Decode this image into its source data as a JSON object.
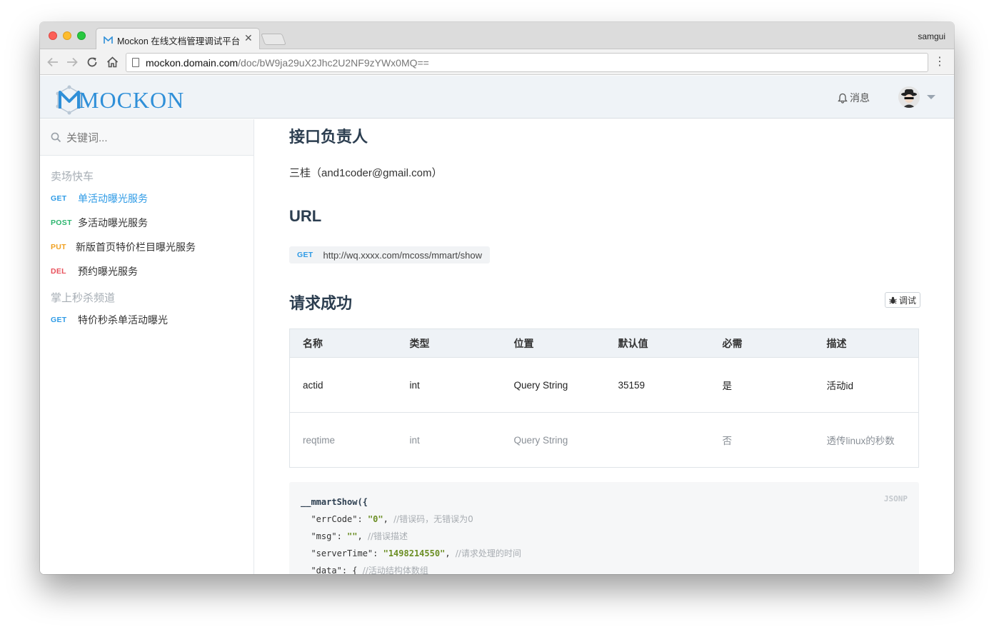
{
  "browser": {
    "tab_title": "Mockon 在线文档管理调试平台",
    "tab_close": "✕",
    "profile_name": "samgui",
    "url_host": "mockon.domain.com",
    "url_path": "/doc/bW9ja29uX2Jhc2U2NF9zYWx0MQ=="
  },
  "header": {
    "logo_text": "MOCKON",
    "notify_label": "消息"
  },
  "sidebar": {
    "search_placeholder": "关键词...",
    "groups": [
      {
        "title": "卖场快车",
        "items": [
          {
            "method": "GET",
            "label": "单活动曝光服务",
            "active": true
          },
          {
            "method": "POST",
            "label": "多活动曝光服务",
            "active": false
          },
          {
            "method": "PUT",
            "label": "新版首页特价栏目曝光服务",
            "active": false
          },
          {
            "method": "DEL",
            "label": "预约曝光服务",
            "active": false
          }
        ]
      },
      {
        "title": "掌上秒杀频道",
        "items": [
          {
            "method": "GET",
            "label": "特价秒杀单活动曝光",
            "active": false
          }
        ]
      }
    ]
  },
  "main": {
    "owner_heading": "接口负责人",
    "owner_text": "三桂（and1coder@gmail.com）",
    "url_heading": "URL",
    "url_method": "GET",
    "url_value": "http://wq.xxxx.com/mcoss/mmart/show",
    "success_heading": "请求成功",
    "debug_label": "调试",
    "table": {
      "headers": [
        "名称",
        "类型",
        "位置",
        "默认值",
        "必需",
        "描述"
      ],
      "rows": [
        [
          "actid",
          "int",
          "Query String",
          "35159",
          "是",
          "活动id"
        ],
        [
          "reqtime",
          "int",
          "Query String",
          "",
          "否",
          "透传linux的秒数"
        ]
      ]
    },
    "code": {
      "lang": "JSONP",
      "fn": "__mmartShow",
      "open": "({",
      "lines": [
        {
          "key": "\"errCode\"",
          "value": "\"0\"",
          "comment": "//错误码，无错误为0"
        },
        {
          "key": "\"msg\"",
          "value": "\"\"",
          "comment": "//错误描述"
        },
        {
          "key": "\"serverTime\"",
          "value": "\"1498214550\"",
          "comment": "//请求处理的时间"
        },
        {
          "key": "\"data\"",
          "value": "{",
          "comment": "//活动结构体数组"
        }
      ]
    }
  },
  "colors": {
    "GET": "#2f9be6",
    "POST": "#2bb56e",
    "PUT": "#f0a020",
    "DEL": "#e8505b",
    "active_link": "#2f9be6",
    "brand": "#2f8fd8"
  }
}
